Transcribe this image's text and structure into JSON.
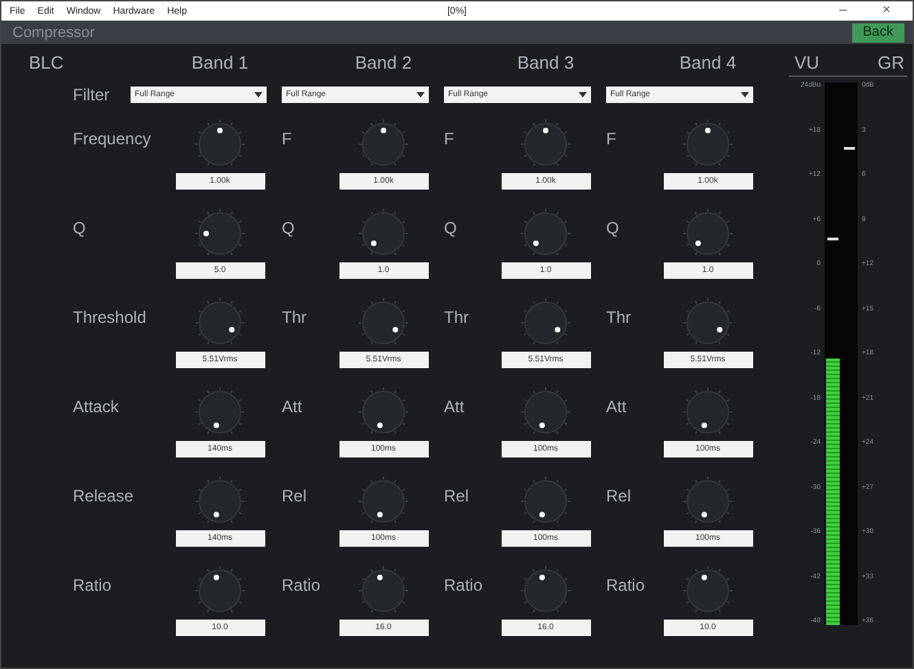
{
  "menu": [
    "File",
    "Edit",
    "Window",
    "Hardware",
    "Help"
  ],
  "window": {
    "title": "[0%]",
    "minimize": "–",
    "close": "×"
  },
  "title_bar": {
    "title": "Compressor",
    "back": "Back"
  },
  "header": {
    "section": "BLC",
    "bands": [
      "Band 1",
      "Band 2",
      "Band 3",
      "Band 4"
    ]
  },
  "filter": {
    "label": "Filter",
    "values": [
      "Full Range",
      "Full Range",
      "Full Range",
      "Full Range"
    ]
  },
  "rows": [
    {
      "cells": [
        {
          "label": "Frequency",
          "value": "1.00k"
        },
        {
          "label": "F",
          "value": "1.00k"
        },
        {
          "label": "F",
          "value": "1.00k"
        },
        {
          "label": "F",
          "value": "1.00k"
        }
      ]
    },
    {
      "cells": [
        {
          "label": "Q",
          "value": "5.0"
        },
        {
          "label": "Q",
          "value": "1.0"
        },
        {
          "label": "Q",
          "value": "1.0"
        },
        {
          "label": "Q",
          "value": "1.0"
        }
      ]
    },
    {
      "cells": [
        {
          "label": "Threshold",
          "value": "5.51Vrms"
        },
        {
          "label": "Thr",
          "value": "5.51Vrms"
        },
        {
          "label": "Thr",
          "value": "5.51Vrms"
        },
        {
          "label": "Thr",
          "value": "5.51Vrms"
        }
      ]
    },
    {
      "cells": [
        {
          "label": "Attack",
          "value": "140ms"
        },
        {
          "label": "Att",
          "value": "100ms"
        },
        {
          "label": "Att",
          "value": "100ms"
        },
        {
          "label": "Att",
          "value": "100ms"
        }
      ]
    },
    {
      "cells": [
        {
          "label": "Release",
          "value": "140ms"
        },
        {
          "label": "Rel",
          "value": "100ms"
        },
        {
          "label": "Rel",
          "value": "100ms"
        },
        {
          "label": "Rel",
          "value": "100ms"
        }
      ]
    },
    {
      "cells": [
        {
          "label": "Ratio",
          "value": "10.0"
        },
        {
          "label": "Ratio",
          "value": "16.0"
        },
        {
          "label": "Ratio",
          "value": "16.0"
        },
        {
          "label": "Ratio",
          "value": "10.0"
        }
      ]
    }
  ],
  "meters": {
    "vu_label": "VU",
    "gr_label": "GR",
    "vu": {
      "level": 0.49,
      "peak": {
        "level": 0.71
      }
    },
    "vu_scale": [
      "24dBu",
      "+18",
      "+12",
      "+6",
      "0",
      "-6",
      "-12",
      "-18",
      "-24",
      "-30",
      "-36",
      "-42",
      "-48"
    ],
    "gr_scale": [
      "0dB",
      "3",
      "6",
      "9",
      "+12",
      "+15",
      "+18",
      "+21",
      "+24",
      "+27",
      "+30",
      "+33",
      "+36"
    ]
  }
}
